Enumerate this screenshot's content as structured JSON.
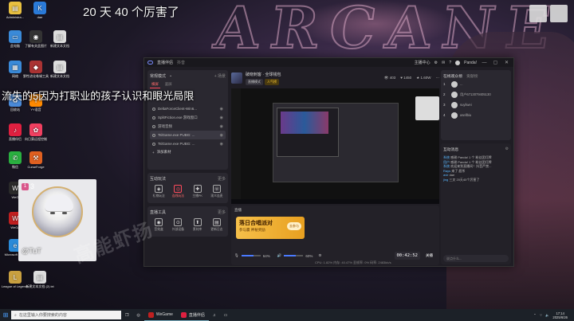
{
  "desktop": {
    "top_text": "20 天 40 个厉害了",
    "overlay_caption": "流失的5因为打职业的孩子认识和眼光局限",
    "icons": [
      {
        "label": "Administra...",
        "color": "#e8c040",
        "glyph": "▤"
      },
      {
        "label": "dae",
        "color": "#2a7ad8",
        "glyph": "K"
      },
      {
        "label": "此电脑",
        "color": "#3a8ad8",
        "glyph": "▭"
      },
      {
        "label": "了解有关此图片",
        "color": "#333",
        "glyph": "◉"
      },
      {
        "label": "新建文本文档",
        "color": "#ddd",
        "glyph": "▤"
      },
      {
        "label": "网络",
        "color": "#3a8ad8",
        "glyph": "▦"
      },
      {
        "label": "野性进化卷锡工具",
        "color": "#a33",
        "glyph": "◆"
      },
      {
        "label": "新建文本文档",
        "color": "#ddd",
        "glyph": "▤"
      },
      {
        "label": "回收站",
        "color": "#4a8ad8",
        "glyph": "♻"
      },
      {
        "label": "YY语音",
        "color": "#ff8a00",
        "glyph": "Y"
      },
      {
        "label": "直播伴侣",
        "color": "#e02040",
        "glyph": "♪"
      },
      {
        "label": "向日葵远程控制",
        "color": "#f04060",
        "glyph": "✿"
      },
      {
        "label": "微信",
        "color": "#2ab040",
        "glyph": "✆"
      },
      {
        "label": "CurseForge",
        "color": "#e06020",
        "glyph": "⚒"
      },
      {
        "label": "WeG",
        "color": "#2a2a2a",
        "glyph": "W"
      },
      {
        "label": "WeGa",
        "color": "#c02020",
        "glyph": "W"
      },
      {
        "label": "Microsoft Edge",
        "color": "#2a8ad8",
        "glyph": "e"
      },
      {
        "label": "League of Legends",
        "color": "#c8a040",
        "glyph": "L"
      },
      {
        "label": "新建文本文档 (2).txt",
        "color": "#ddd",
        "glyph": "▤"
      }
    ]
  },
  "app": {
    "title": "直播伴侣",
    "title_sub": "抖音",
    "user": "Panda!",
    "top_actions": [
      "主播中心",
      "设置",
      "消息"
    ],
    "scene_mode": "常规模式",
    "scene_tab_active": "横屏",
    "scene_tab_other": "竖屏",
    "add_scene": "+ 场景",
    "sources": [
      {
        "name": "DeltaForceClient-Win6..."
      },
      {
        "name": "SplitFiction.exe 游戏窗口"
      },
      {
        "name": "游戏音频"
      },
      {
        "name": "TslGame.exe PUBG: ..."
      },
      {
        "name": "TslGame.exe PUBG: ..."
      }
    ],
    "add_source": "添加素材",
    "interact_title": "互动玩法",
    "interact_more": "更多",
    "interact_tools": [
      {
        "label": "礼物玩法",
        "glyph": "◈"
      },
      {
        "label": "连线玩法",
        "glyph": "◎",
        "hot": true
      },
      {
        "label": "主播PK",
        "glyph": "✚"
      },
      {
        "label": "观众连麦",
        "glyph": "☏"
      }
    ],
    "live_tools_title": "直播工具",
    "live_tools_more": "更多",
    "live_tools": [
      {
        "label": "音效盒",
        "glyph": "◉"
      },
      {
        "label": "外部设备",
        "glyph": "⊙"
      },
      {
        "label": "素材库",
        "glyph": "⬆"
      },
      {
        "label": "更新日志",
        "glyph": "▤"
      }
    ],
    "channel": {
      "name": "破晓刺客 · 全球钱包",
      "tag1": "直播模式",
      "tag2": "人气榜",
      "stats": [
        "403",
        "1450",
        "1.60W"
      ]
    },
    "ctrl_title": "直播",
    "promo": {
      "title": "落日合唱派对",
      "sub": "参与赢 神秘奖励",
      "btn": "去参与"
    },
    "volume_mic": "64%",
    "volume_sys": "60%",
    "mic_value": 0.64,
    "sys_value": 0.6,
    "timer": "00:42:52",
    "live_btn": "关播",
    "cpu": "CPU: 1.82%   内存: 40.47%   丢帧率: 0%   码率: 2483kb/s",
    "audience_title": "在线观众榜",
    "audience_tab2": "贡献榜",
    "audience": [
      {
        "rank": "1",
        "name": "..."
      },
      {
        "rank": "2",
        "name": "用户6713079405130"
      },
      {
        "rank": "3",
        "name": "suyliwei"
      },
      {
        "rank": "4",
        "name": "asellbiu"
      }
    ],
    "chat_title": "互动消息",
    "chat_lines": [
      {
        "u": "系统",
        "t": "感谢 Panda! 1 个 粉丝团灯牌"
      },
      {
        "u": "用户",
        "t": "感谢 Panda! 1 个 粉丝团灯牌"
      },
      {
        "u": "系统",
        "t": "欢迎来到直播间！抖音严禁..."
      },
      {
        "u": "Rays",
        "t": "来了 超杀"
      },
      {
        "u": "avir",
        "t": "dae"
      },
      {
        "u": "jing",
        "t": "三叉 20天40个厉害了"
      }
    ],
    "chat_placeholder": "说点什么..."
  },
  "camera": {
    "badge": "3",
    "name": "@TuT"
  },
  "watermark": "高能虾扬",
  "taskbar": {
    "search": "在这里输入你要搜索的内容",
    "apps": [
      {
        "label": "WeGame",
        "color": "#c02020"
      },
      {
        "label": "直播伴侣",
        "color": "#e02040"
      }
    ],
    "time": "17:14",
    "date": "2025/6/26"
  }
}
